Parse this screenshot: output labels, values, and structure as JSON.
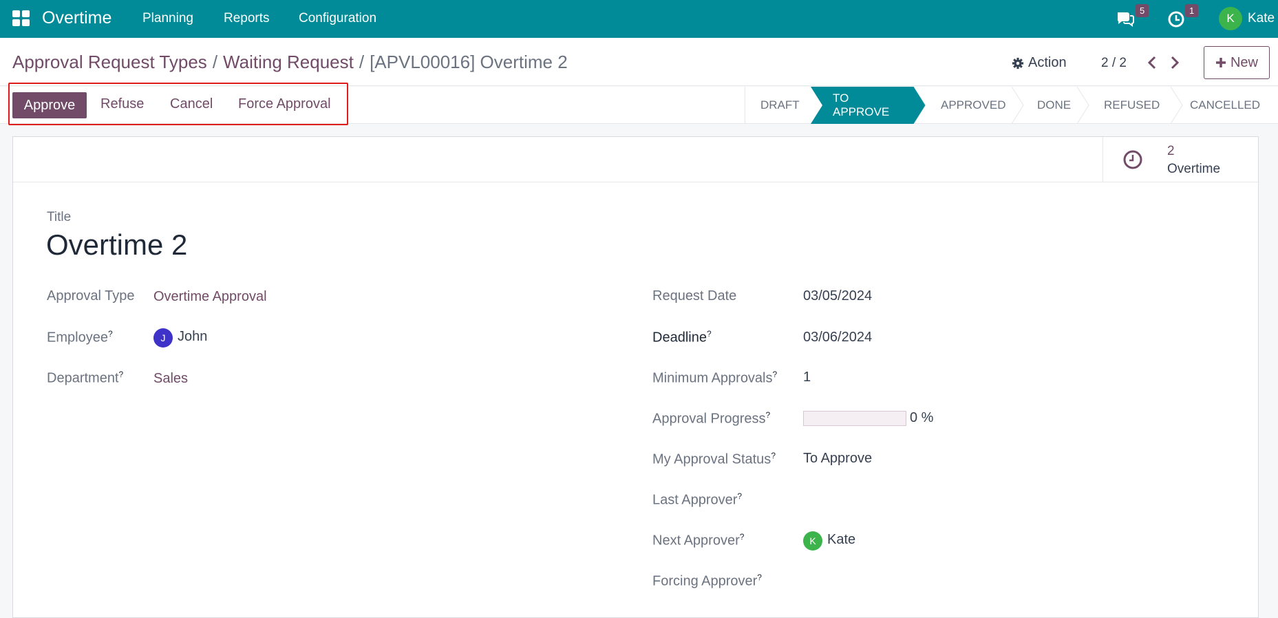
{
  "navbar": {
    "app_name": "Overtime",
    "menu": [
      "Planning",
      "Reports",
      "Configuration"
    ],
    "messages_count": "5",
    "activities_count": "1",
    "user_initial": "K",
    "user_name": "Kate",
    "accent_color": "#018b98"
  },
  "breadcrumb": {
    "items": [
      "Approval Request Types",
      "Waiting Request"
    ],
    "current": "[APVL00016] Overtime 2"
  },
  "control": {
    "action_label": "Action",
    "pager": "2 / 2",
    "new_label": "New"
  },
  "buttons": {
    "approve": "Approve",
    "refuse": "Refuse",
    "cancel": "Cancel",
    "force_approval": "Force Approval"
  },
  "stages": [
    {
      "label": "Draft",
      "active": false
    },
    {
      "label": "To Approve",
      "active": true
    },
    {
      "label": "Approved",
      "active": false
    },
    {
      "label": "Done",
      "active": false
    },
    {
      "label": "Refused",
      "active": false
    },
    {
      "label": "Cancelled",
      "active": false
    }
  ],
  "smart_button": {
    "value": "2",
    "label": "Overtime",
    "icon": "clock-icon"
  },
  "form": {
    "title_label": "Title",
    "title": "Overtime 2",
    "left": {
      "approval_type_label": "Approval Type",
      "approval_type": "Overtime Approval",
      "employee_label": "Employee",
      "employee_initial": "J",
      "employee": "John",
      "department_label": "Department",
      "department": "Sales"
    },
    "right": {
      "request_date_label": "Request Date",
      "request_date": "03/05/2024",
      "deadline_label": "Deadline",
      "deadline": "03/06/2024",
      "min_approvals_label": "Minimum Approvals",
      "min_approvals": "1",
      "progress_label": "Approval Progress",
      "progress_value": 0,
      "progress_text": "0 %",
      "my_status_label": "My Approval Status",
      "my_status": "To Approve",
      "last_approver_label": "Last Approver",
      "next_approver_label": "Next Approver",
      "next_approver_initial": "K",
      "next_approver": "Kate",
      "forcing_approver_label": "Forcing Approver"
    },
    "help_mark": "?"
  }
}
